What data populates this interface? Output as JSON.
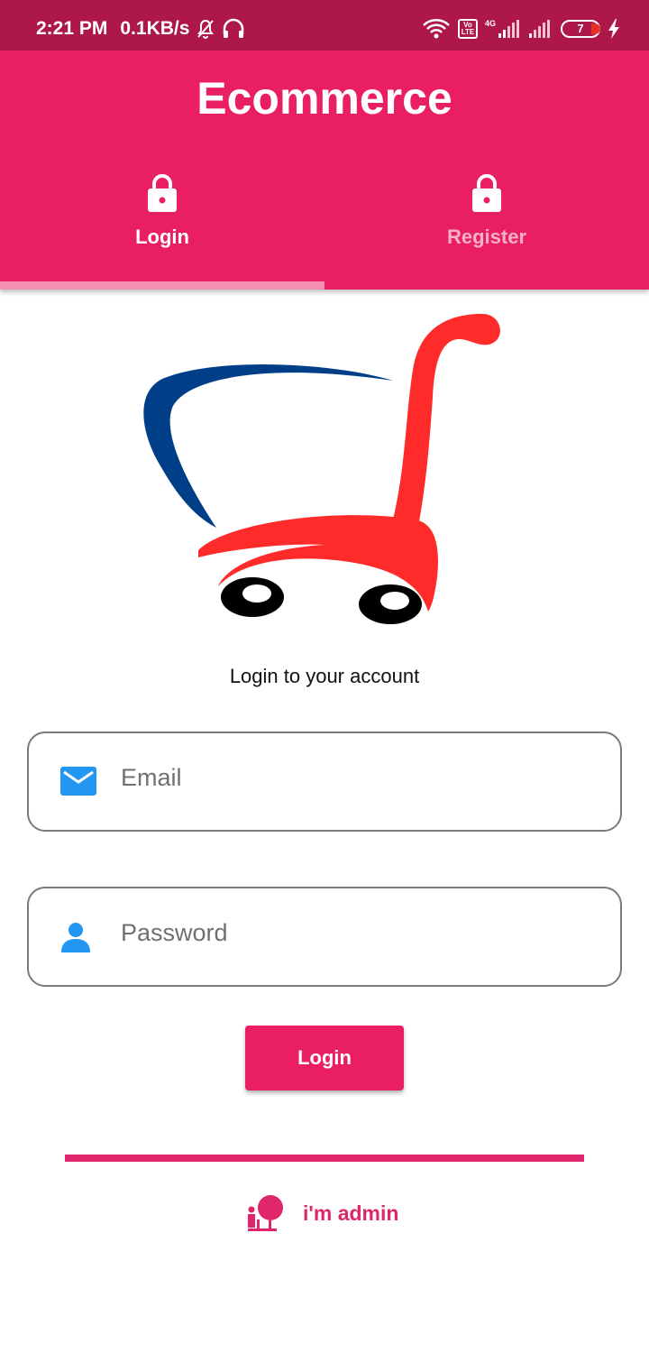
{
  "status_bar": {
    "time": "2:21 PM",
    "speed": "0.1KB/s",
    "network": "4G",
    "volte": "Vo LTE",
    "battery": "7"
  },
  "app_bar": {
    "title": "Ecommerce",
    "tabs": [
      {
        "label": "Login",
        "icon": "lock-icon",
        "selected": true
      },
      {
        "label": "Register",
        "icon": "lock-icon",
        "selected": false
      }
    ]
  },
  "main": {
    "subtitle": "Login to your account",
    "email": {
      "placeholder": "Email",
      "value": "",
      "icon": "email-icon"
    },
    "password": {
      "placeholder": "Password",
      "value": "",
      "icon": "person-icon"
    },
    "login_button": "Login",
    "admin_link": "i'm admin"
  },
  "colors": {
    "status_bar": "#ad1749",
    "primary": "#e91e63",
    "tab_indicator": "#f48fb1",
    "icon_blue": "#2196f3",
    "logo_blue": "#003f88",
    "logo_red": "#ff2a2a"
  }
}
